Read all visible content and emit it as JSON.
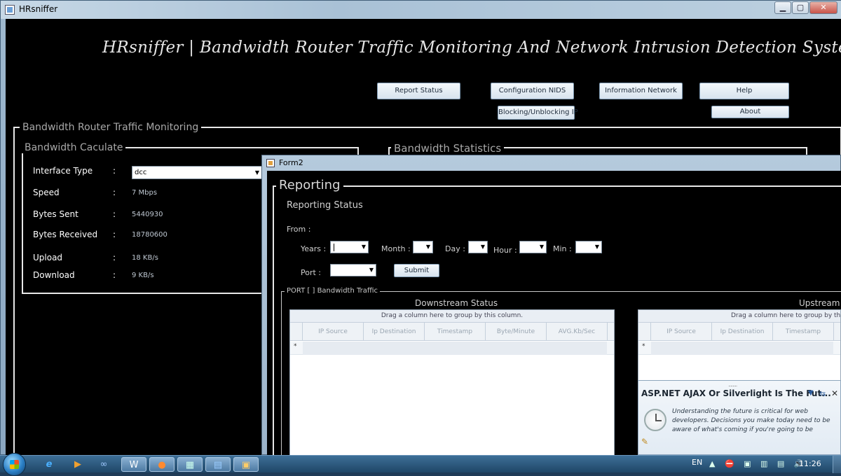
{
  "main_window": {
    "title": "HRsniffer",
    "controls": {
      "minimize": "▁",
      "maximize": "▢",
      "close": "✕"
    },
    "heading": "HRsniffer | Bandwidth Router Traffic Monitoring And Network Intrusion Detection System |",
    "buttons": {
      "report_status": "Report Status",
      "configuration_nids": "Configuration NIDS",
      "information_network": "Information Network",
      "help": "Help",
      "blocking": "Blocking/Unblocking IP",
      "about": "About"
    },
    "groups": {
      "monitoring": "Bandwidth Router Traffic Monitoring",
      "calculate": "Bandwidth Caculate",
      "statistics": "Bandwidth  Statistics"
    },
    "calc_rows": [
      {
        "label": "Interface Type",
        "value": "dcc"
      },
      {
        "label": "Speed",
        "value": "7 Mbps"
      },
      {
        "label": "Bytes Sent",
        "value": "5440930"
      },
      {
        "label": "Bytes Received",
        "value": "18780600"
      },
      {
        "label": "Upload",
        "value": "18 KB/s"
      },
      {
        "label": "Download",
        "value": "9 KB/s"
      }
    ],
    "colon": ":"
  },
  "form2": {
    "title": "Form2",
    "group_title": "Reporting",
    "subtitle": "Reporting Status",
    "from_label": "From   :",
    "fields": {
      "years": "Years :",
      "month": "Month :",
      "day": "Day :",
      "hour": "Hour :",
      "min": "Min :",
      "port": "Port   :"
    },
    "submit": "Submit",
    "port_group": "PORT [  ] Bandwidth Traffic",
    "downstream": {
      "title": "Downstream Status",
      "group_panel": "Drag a column here to group by this column.",
      "columns": [
        "IP Source",
        "Ip Destination",
        "Timestamp",
        "Byte/Minute",
        "AVG.Kb/Sec"
      ]
    },
    "upstream": {
      "title": "Upstream S",
      "group_panel": "Drag a column here to group by thi",
      "columns": [
        "IP Source",
        "Ip Destination",
        "Timestamp"
      ]
    },
    "new_row_marker": "*"
  },
  "notification": {
    "grip": "........",
    "title": "ASP.NET AJAX Or Silverlight Is The Fut...",
    "body": "Understanding the future is critical for web developers. Decisions you make today need to be aware of what's coming if you're going to be",
    "menu_icon": "▼",
    "pin_icon": "⇆",
    "close_icon": "✕"
  },
  "taskbar": {
    "language": "EN",
    "clock": "11:26",
    "tray": "▲ ⛔ ▣ ▥ ▤ 🔊"
  }
}
